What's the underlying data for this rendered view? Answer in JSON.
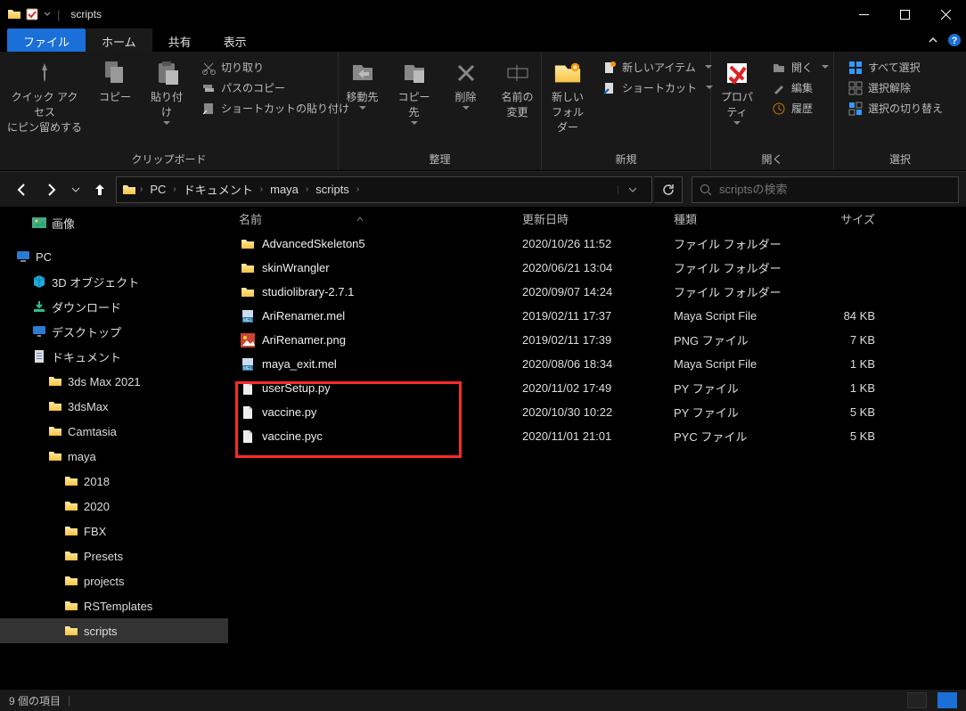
{
  "window": {
    "title": "scripts"
  },
  "tabs": {
    "file": "ファイル",
    "home": "ホーム",
    "share": "共有",
    "view": "表示"
  },
  "ribbon": {
    "clipboard": {
      "label": "クリップボード",
      "pin": "クイック アクセス\nにピン留めする",
      "copy": "コピー",
      "paste": "貼り付け",
      "cut": "切り取り",
      "copy_path": "パスのコピー",
      "paste_shortcut": "ショートカットの貼り付け"
    },
    "organize": {
      "label": "整理",
      "move": "移動先",
      "copy_to": "コピー先",
      "delete": "削除",
      "rename": "名前の\n変更"
    },
    "new": {
      "label": "新規",
      "new_folder": "新しい\nフォルダー",
      "new_item": "新しいアイテム",
      "shortcut": "ショートカット"
    },
    "open": {
      "label": "開く",
      "properties": "プロパティ",
      "open": "開く",
      "edit": "編集",
      "history": "履歴"
    },
    "select": {
      "label": "選択",
      "select_all": "すべて選択",
      "select_none": "選択解除",
      "invert": "選択の切り替え"
    }
  },
  "breadcrumbs": [
    "PC",
    "ドキュメント",
    "maya",
    "scripts"
  ],
  "search": {
    "placeholder": "scriptsの検索"
  },
  "sidebar": {
    "pictures": "画像",
    "pc": "PC",
    "pc_children": [
      {
        "label": "3D オブジェクト",
        "icon": "cube"
      },
      {
        "label": "ダウンロード",
        "icon": "download"
      },
      {
        "label": "デスクトップ",
        "icon": "desktop"
      },
      {
        "label": "ドキュメント",
        "icon": "document",
        "sel": false,
        "children": [
          {
            "label": "3ds Max 2021"
          },
          {
            "label": "3dsMax"
          },
          {
            "label": "Camtasia"
          },
          {
            "label": "maya",
            "children": [
              "2018",
              "2020",
              "FBX",
              "Presets",
              "projects",
              "RSTemplates",
              "scripts"
            ]
          }
        ]
      }
    ]
  },
  "columns": {
    "name": "名前",
    "date": "更新日時",
    "type": "種類",
    "size": "サイズ"
  },
  "files": [
    {
      "name": "AdvancedSkeleton5",
      "date": "2020/10/26 11:52",
      "type": "ファイル フォルダー",
      "size": "",
      "icon": "folder"
    },
    {
      "name": "skinWrangler",
      "date": "2020/06/21 13:04",
      "type": "ファイル フォルダー",
      "size": "",
      "icon": "folder"
    },
    {
      "name": "studiolibrary-2.7.1",
      "date": "2020/09/07 14:24",
      "type": "ファイル フォルダー",
      "size": "",
      "icon": "folder"
    },
    {
      "name": "AriRenamer.mel",
      "date": "2019/02/11 17:37",
      "type": "Maya Script File",
      "size": "84 KB",
      "icon": "mel"
    },
    {
      "name": "AriRenamer.png",
      "date": "2019/02/11 17:39",
      "type": "PNG ファイル",
      "size": "7 KB",
      "icon": "png"
    },
    {
      "name": "maya_exit.mel",
      "date": "2020/08/06 18:34",
      "type": "Maya Script File",
      "size": "1 KB",
      "icon": "mel"
    },
    {
      "name": "userSetup.py",
      "date": "2020/11/02 17:49",
      "type": "PY ファイル",
      "size": "1 KB",
      "icon": "file",
      "hl": true
    },
    {
      "name": "vaccine.py",
      "date": "2020/10/30 10:22",
      "type": "PY ファイル",
      "size": "5 KB",
      "icon": "file",
      "hl": true
    },
    {
      "name": "vaccine.pyc",
      "date": "2020/11/01 21:01",
      "type": "PYC ファイル",
      "size": "5 KB",
      "icon": "file",
      "hl": true
    }
  ],
  "status": {
    "items": "9 個の項目"
  }
}
